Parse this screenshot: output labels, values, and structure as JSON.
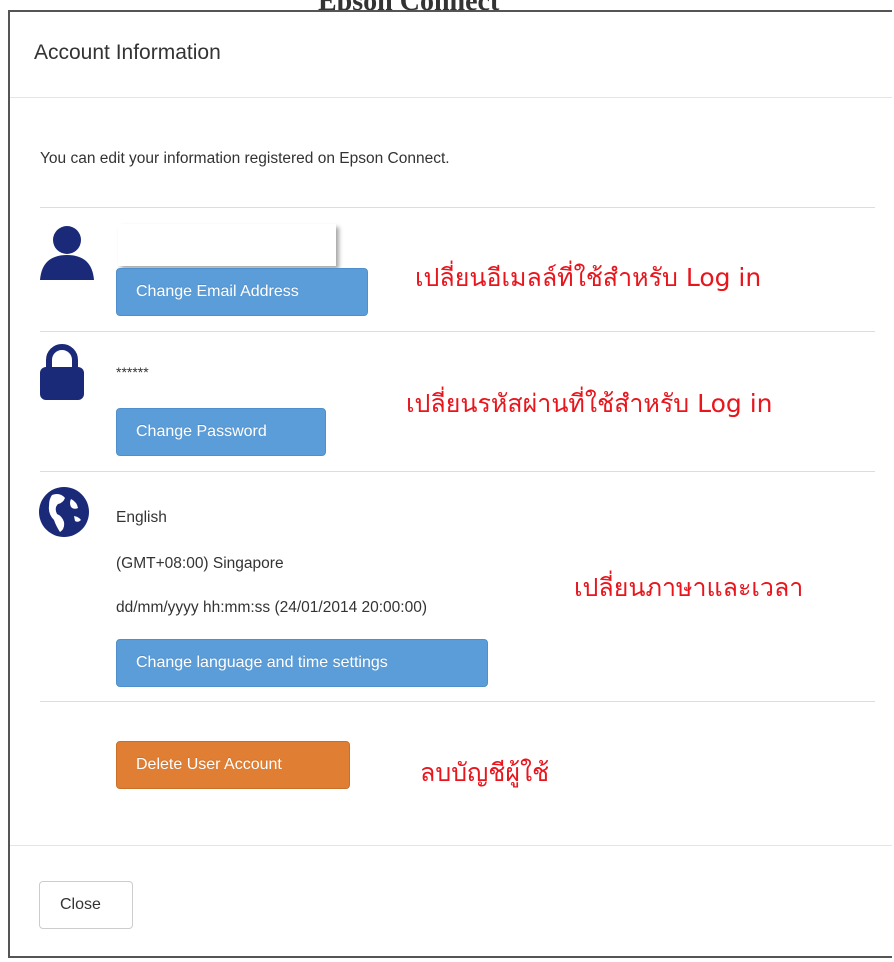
{
  "backdrop": {
    "title_fragment": "Epson Connect"
  },
  "modal": {
    "title": "Account Information",
    "intro": "You can edit your information registered on Epson Connect."
  },
  "email_section": {
    "icon": "user-icon",
    "value": "",
    "button_label": "Change Email Address",
    "annotation": "เปลี่ยนอีเมลล์ที่ใช้สำหรับ Log in"
  },
  "password_section": {
    "icon": "lock-icon",
    "value": "******",
    "button_label": "Change Password",
    "annotation": "เปลี่ยนรหัสผ่านที่ใช้สำหรับ Log in"
  },
  "language_section": {
    "icon": "globe-icon",
    "language": "English",
    "timezone": "(GMT+08:00) Singapore",
    "datetime_format": "dd/mm/yyyy hh:mm:ss (24/01/2014 20:00:00)",
    "button_label": "Change language and time settings",
    "annotation": "เปลี่ยนภาษาและเวลา"
  },
  "delete_section": {
    "button_label": "Delete User Account",
    "annotation": "ลบบัญชีผู้ใช้"
  },
  "footer": {
    "close_label": "Close"
  },
  "colors": {
    "primary_button": "#5b9dd9",
    "danger_button": "#e07f33",
    "icon_navy": "#1b2a78",
    "annotation_red": "#e8151d"
  }
}
